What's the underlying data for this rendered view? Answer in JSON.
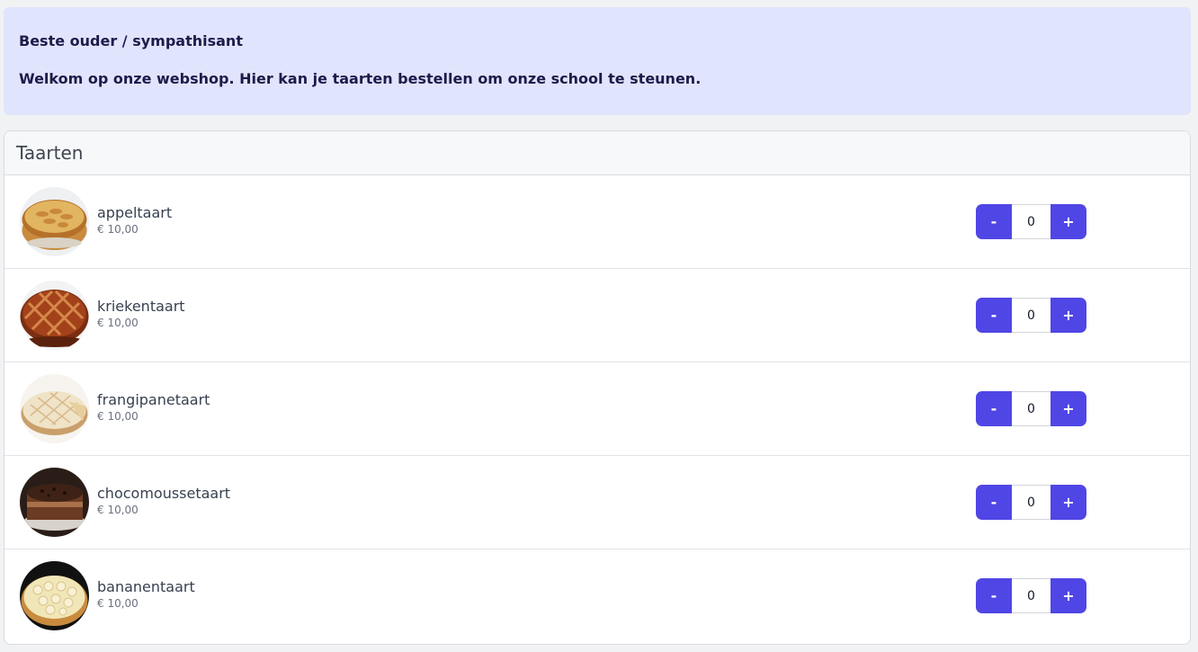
{
  "banner": {
    "greeting": "Beste ouder / sympathisant",
    "welcome": "Welkom op onze webshop. Hier kan je taarten bestellen om onze school te steunen."
  },
  "section": {
    "title": "Taarten"
  },
  "products": [
    {
      "name": "appeltaart",
      "price": "€ 10,00",
      "quantity": "0",
      "minus_label": "-",
      "plus_label": "+",
      "image": "apple-pie-photo"
    },
    {
      "name": "kriekentaart",
      "price": "€ 10,00",
      "quantity": "0",
      "minus_label": "-",
      "plus_label": "+",
      "image": "cherry-pie-photo"
    },
    {
      "name": "frangipanetaart",
      "price": "€ 10,00",
      "quantity": "0",
      "minus_label": "-",
      "plus_label": "+",
      "image": "frangipane-pie-photo"
    },
    {
      "name": "chocomoussetaart",
      "price": "€ 10,00",
      "quantity": "0",
      "minus_label": "-",
      "plus_label": "+",
      "image": "chocolate-mousse-cake-photo"
    },
    {
      "name": "bananentaart",
      "price": "€ 10,00",
      "quantity": "0",
      "minus_label": "-",
      "plus_label": "+",
      "image": "banana-pie-photo"
    }
  ],
  "colors": {
    "accent": "#5046e5",
    "banner_bg": "#e0e5fd",
    "banner_text": "#1e1b4b"
  }
}
